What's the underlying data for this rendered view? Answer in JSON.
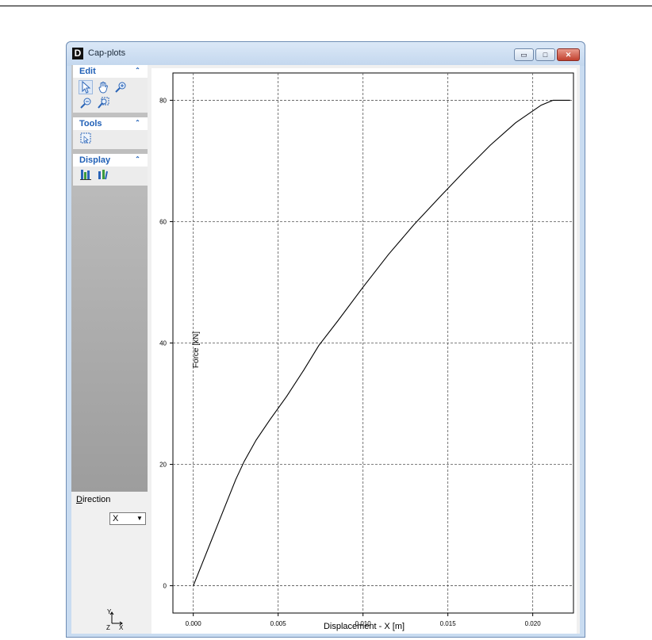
{
  "window": {
    "title": "Cap-plots",
    "app_icon_letter": "D",
    "minimize_glyph": "▭",
    "maximize_glyph": "□",
    "close_glyph": "✕"
  },
  "sidebar": {
    "panels": [
      {
        "label": "Edit",
        "icons": [
          "pointer-icon",
          "pan-hand-icon",
          "zoom-in-icon",
          "zoom-out-icon",
          "zoom-extent-icon"
        ]
      },
      {
        "label": "Tools",
        "icons": [
          "select-region-icon"
        ]
      },
      {
        "label": "Display",
        "icons": [
          "display-option-1-icon",
          "display-option-2-icon"
        ]
      }
    ],
    "collapse_glyph": "⌃",
    "direction": {
      "label_first": "D",
      "label_rest": "irection",
      "selected": "X",
      "options": [
        "X"
      ]
    },
    "axes_indicator": {
      "y": "Y",
      "z": "Z",
      "x": "X"
    }
  },
  "chart_data": {
    "type": "line",
    "title": "",
    "xlabel": "Displacement  - X [m]",
    "ylabel": "Force [kN]",
    "xlim": [
      -0.0012,
      0.0224
    ],
    "ylim": [
      -4.5,
      84.5
    ],
    "xticks": [
      0.0,
      0.005,
      0.01,
      0.015,
      0.02
    ],
    "xtick_labels": [
      "0.000",
      "0.005",
      "0.010",
      "0.015",
      "0.020"
    ],
    "yticks": [
      0,
      20,
      40,
      60,
      80
    ],
    "ytick_labels": [
      "0",
      "20",
      "40",
      "60",
      "80"
    ],
    "grid": true,
    "series": [
      {
        "x": [
          0.0,
          0.0005,
          0.001,
          0.0015,
          0.002,
          0.0025,
          0.003,
          0.0037,
          0.0045,
          0.0055,
          0.0065,
          0.0074,
          0.0085,
          0.01,
          0.0115,
          0.013,
          0.0145,
          0.016,
          0.0175,
          0.019,
          0.0205,
          0.0212,
          0.0222
        ],
        "y": [
          0,
          3.5,
          7,
          10.5,
          14,
          17.5,
          20.5,
          24,
          27.3,
          31.2,
          35.5,
          39.6,
          43.6,
          49.2,
          54.6,
          59.5,
          64,
          68.4,
          72.6,
          76.3,
          79.2,
          80,
          80
        ]
      }
    ]
  }
}
